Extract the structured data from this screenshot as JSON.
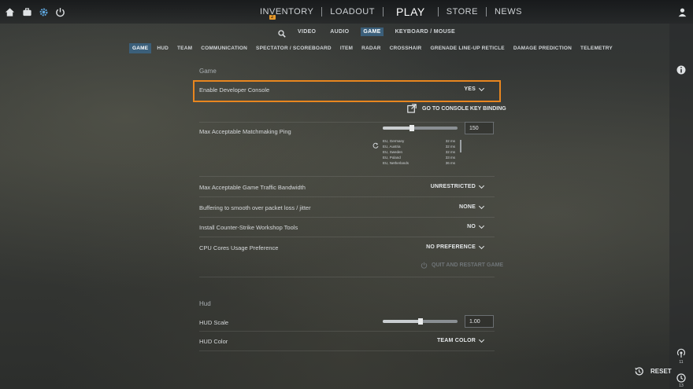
{
  "topbar": {
    "nav": {
      "inventory": "INVENTORY",
      "inventory_badge": "2",
      "loadout": "LOADOUT",
      "play": "PLAY",
      "store": "STORE",
      "news": "NEWS"
    },
    "left_icons": [
      "home-icon",
      "briefcase-icon",
      "gear-icon",
      "power-icon"
    ],
    "right_icon": "profile-icon"
  },
  "subnav": {
    "items": [
      "VIDEO",
      "AUDIO",
      "GAME",
      "KEYBOARD / MOUSE"
    ],
    "active": "GAME"
  },
  "tabs": {
    "items": [
      "GAME",
      "HUD",
      "TEAM",
      "COMMUNICATION",
      "SPECTATOR / SCOREBOARD",
      "ITEM",
      "RADAR",
      "CROSSHAIR",
      "GRENADE LINE-UP RETICLE",
      "DAMAGE PREDICTION",
      "TELEMETRY"
    ],
    "active": "GAME"
  },
  "game_section": {
    "title": "Game",
    "developer_console": {
      "label": "Enable Developer Console",
      "value": "YES"
    },
    "console_link": "GO TO CONSOLE KEY BINDING",
    "matchmaking_ping": {
      "label": "Max Acceptable Matchmaking Ping",
      "value": "150",
      "slider_fraction": 0.39,
      "servers": [
        {
          "name": "EU, Germany",
          "ping": "32 ms"
        },
        {
          "name": "EU, Austria",
          "ping": "32 ms"
        },
        {
          "name": "EU, Sweden",
          "ping": "32 ms"
        },
        {
          "name": "EU, Poland",
          "ping": "33 ms"
        },
        {
          "name": "EU, Netherlands",
          "ping": "36 ms"
        }
      ]
    },
    "traffic_bandwidth": {
      "label": "Max Acceptable Game Traffic Bandwidth",
      "value": "UNRESTRICTED"
    },
    "buffering": {
      "label": "Buffering to smooth over packet loss / jitter",
      "value": "NONE"
    },
    "workshop_tools": {
      "label": "Install Counter-Strike Workshop Tools",
      "value": "NO"
    },
    "cpu_cores": {
      "label": "CPU Cores Usage Preference",
      "value": "NO PREFERENCE"
    },
    "quit_restart": "QUIT AND RESTART GAME"
  },
  "hud_section": {
    "title": "Hud",
    "hud_scale": {
      "label": "HUD Scale",
      "value": "1.00",
      "slider_fraction": 0.5
    },
    "hud_color": {
      "label": "HUD Color",
      "value": "TEAM COLOR"
    }
  },
  "rail": {
    "top_icon": "info-icon",
    "bottom_items": [
      {
        "icon": "broadcast-icon",
        "count": "11"
      },
      {
        "icon": "history-icon",
        "count": "13"
      }
    ]
  },
  "footer": {
    "reset_label": "RESET"
  },
  "colors": {
    "accent_highlight": "#e8861f",
    "active_tab": "#3b5f7a"
  }
}
